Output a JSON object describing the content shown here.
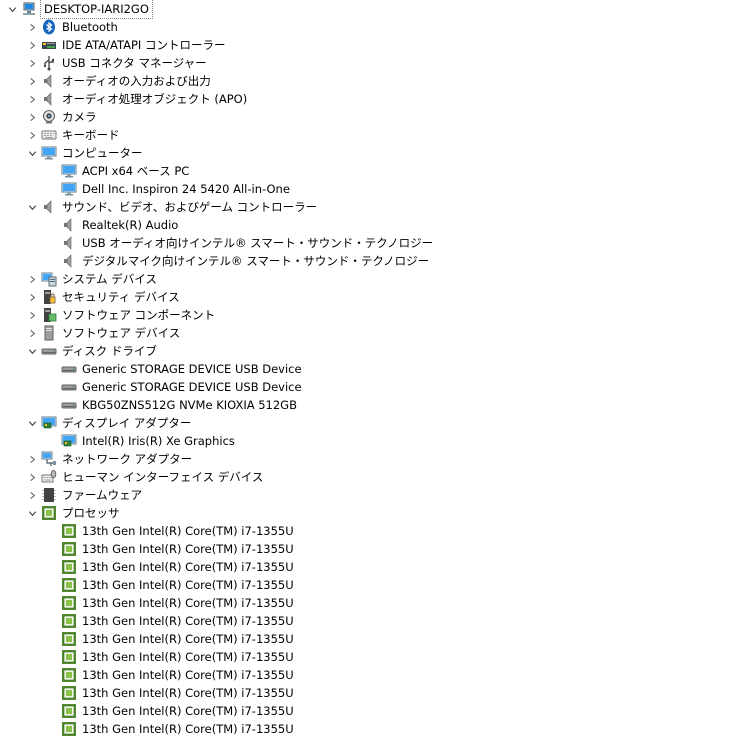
{
  "root": {
    "label": "DESKTOP-IARI2GO",
    "icon": "computer-root-icon",
    "expanded": true
  },
  "categories": [
    {
      "label": "Bluetooth",
      "icon": "bluetooth-icon",
      "expanded": false,
      "children": []
    },
    {
      "label": "IDE ATA/ATAPI コントローラー",
      "icon": "ide-controller-icon",
      "expanded": false,
      "children": []
    },
    {
      "label": "USB コネクタ マネージャー",
      "icon": "usb-icon",
      "expanded": false,
      "children": []
    },
    {
      "label": "オーディオの入力および出力",
      "icon": "speaker-icon",
      "expanded": false,
      "children": []
    },
    {
      "label": "オーディオ処理オブジェクト (APO)",
      "icon": "speaker-icon",
      "expanded": false,
      "children": []
    },
    {
      "label": "カメラ",
      "icon": "camera-icon",
      "expanded": false,
      "children": []
    },
    {
      "label": "キーボード",
      "icon": "keyboard-icon",
      "expanded": false,
      "children": []
    },
    {
      "label": "コンピューター",
      "icon": "monitor-icon",
      "expanded": true,
      "children": [
        {
          "label": "ACPI x64 ベース PC",
          "icon": "monitor-icon"
        },
        {
          "label": "Dell Inc. Inspiron 24 5420 All-in-One",
          "icon": "monitor-icon"
        }
      ]
    },
    {
      "label": "サウンド、ビデオ、およびゲーム コントローラー",
      "icon": "speaker-icon",
      "expanded": true,
      "children": [
        {
          "label": "Realtek(R) Audio",
          "icon": "speaker-icon"
        },
        {
          "label": "USB オーディオ向けインテル® スマート・サウンド・テクノロジー",
          "icon": "speaker-icon"
        },
        {
          "label": "デジタルマイク向けインテル® スマート・サウンド・テクノロジー",
          "icon": "speaker-icon"
        }
      ]
    },
    {
      "label": "システム デバイス",
      "icon": "system-devices-icon",
      "expanded": false,
      "children": []
    },
    {
      "label": "セキュリティ デバイス",
      "icon": "security-device-icon",
      "expanded": false,
      "children": []
    },
    {
      "label": "ソフトウェア コンポーネント",
      "icon": "software-component-icon",
      "expanded": false,
      "children": []
    },
    {
      "label": "ソフトウェア デバイス",
      "icon": "software-device-icon",
      "expanded": false,
      "children": []
    },
    {
      "label": "ディスク ドライブ",
      "icon": "disk-drive-icon",
      "expanded": true,
      "children": [
        {
          "label": "Generic STORAGE DEVICE USB Device",
          "icon": "disk-drive-icon"
        },
        {
          "label": "Generic STORAGE DEVICE USB Device",
          "icon": "disk-drive-icon"
        },
        {
          "label": "KBG50ZNS512G NVMe KIOXIA 512GB",
          "icon": "disk-drive-icon"
        }
      ]
    },
    {
      "label": "ディスプレイ アダプター",
      "icon": "display-adapter-icon",
      "expanded": true,
      "children": [
        {
          "label": "Intel(R) Iris(R) Xe Graphics",
          "icon": "display-adapter-icon"
        }
      ]
    },
    {
      "label": "ネットワーク アダプター",
      "icon": "network-adapter-icon",
      "expanded": false,
      "children": []
    },
    {
      "label": "ヒューマン インターフェイス デバイス",
      "icon": "hid-icon",
      "expanded": false,
      "children": []
    },
    {
      "label": "ファームウェア",
      "icon": "firmware-icon",
      "expanded": false,
      "children": []
    },
    {
      "label": "プロセッサ",
      "icon": "processor-icon",
      "expanded": true,
      "children": [
        {
          "label": "13th Gen Intel(R) Core(TM) i7-1355U",
          "icon": "processor-icon"
        },
        {
          "label": "13th Gen Intel(R) Core(TM) i7-1355U",
          "icon": "processor-icon"
        },
        {
          "label": "13th Gen Intel(R) Core(TM) i7-1355U",
          "icon": "processor-icon"
        },
        {
          "label": "13th Gen Intel(R) Core(TM) i7-1355U",
          "icon": "processor-icon"
        },
        {
          "label": "13th Gen Intel(R) Core(TM) i7-1355U",
          "icon": "processor-icon"
        },
        {
          "label": "13th Gen Intel(R) Core(TM) i7-1355U",
          "icon": "processor-icon"
        },
        {
          "label": "13th Gen Intel(R) Core(TM) i7-1355U",
          "icon": "processor-icon"
        },
        {
          "label": "13th Gen Intel(R) Core(TM) i7-1355U",
          "icon": "processor-icon"
        },
        {
          "label": "13th Gen Intel(R) Core(TM) i7-1355U",
          "icon": "processor-icon"
        },
        {
          "label": "13th Gen Intel(R) Core(TM) i7-1355U",
          "icon": "processor-icon"
        },
        {
          "label": "13th Gen Intel(R) Core(TM) i7-1355U",
          "icon": "processor-icon"
        },
        {
          "label": "13th Gen Intel(R) Core(TM) i7-1355U",
          "icon": "processor-icon"
        }
      ]
    }
  ]
}
